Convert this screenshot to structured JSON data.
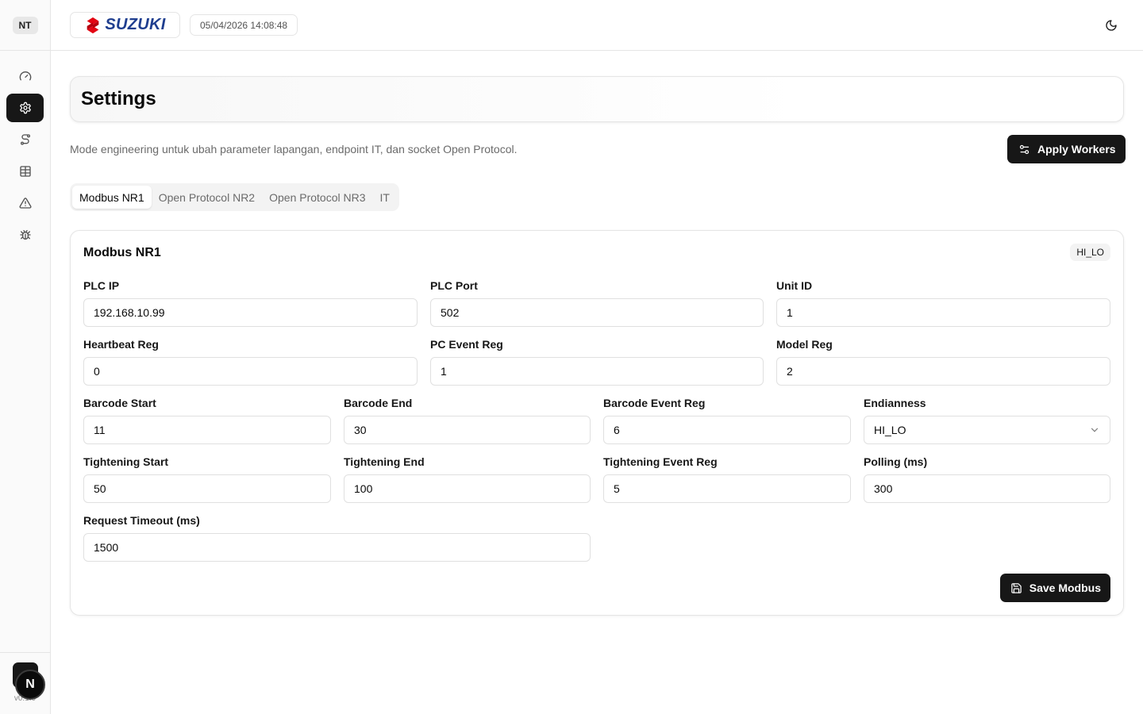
{
  "sidebar": {
    "avatar": "NT",
    "version": "v0.1.0",
    "badge": "N",
    "items": [
      {
        "name": "dashboard",
        "icon": "gauge-icon"
      },
      {
        "name": "settings",
        "icon": "gear-icon",
        "active": true
      },
      {
        "name": "workflow",
        "icon": "workflow-icon"
      },
      {
        "name": "table",
        "icon": "table-icon"
      },
      {
        "name": "alerts",
        "icon": "warning-icon"
      },
      {
        "name": "debug",
        "icon": "bug-icon"
      }
    ]
  },
  "header": {
    "brand": "SUZUKI",
    "datetime": "05/04/2026 14:08:48",
    "theme_icon": "moon-icon"
  },
  "page": {
    "title": "Settings",
    "description": "Mode engineering untuk ubah parameter lapangan, endpoint IT, dan socket Open Protocol.",
    "apply_label": "Apply Workers"
  },
  "tabs": [
    {
      "label": "Modbus NR1",
      "active": true
    },
    {
      "label": "Open Protocol NR2"
    },
    {
      "label": "Open Protocol NR3"
    },
    {
      "label": "IT"
    }
  ],
  "card": {
    "title": "Modbus NR1",
    "badge": "HI_LO",
    "save_label": "Save Modbus",
    "fields": {
      "plc_ip": {
        "label": "PLC IP",
        "value": "192.168.10.99"
      },
      "plc_port": {
        "label": "PLC Port",
        "value": "502"
      },
      "unit_id": {
        "label": "Unit ID",
        "value": "1"
      },
      "heartbeat_reg": {
        "label": "Heartbeat Reg",
        "value": "0"
      },
      "pc_event_reg": {
        "label": "PC Event Reg",
        "value": "1"
      },
      "model_reg": {
        "label": "Model Reg",
        "value": "2"
      },
      "barcode_start": {
        "label": "Barcode Start",
        "value": "11"
      },
      "barcode_end": {
        "label": "Barcode End",
        "value": "30"
      },
      "barcode_event_reg": {
        "label": "Barcode Event Reg",
        "value": "6"
      },
      "endianness": {
        "label": "Endianness",
        "value": "HI_LO"
      },
      "tightening_start": {
        "label": "Tightening Start",
        "value": "50"
      },
      "tightening_end": {
        "label": "Tightening End",
        "value": "100"
      },
      "tightening_event_reg": {
        "label": "Tightening Event Reg",
        "value": "5"
      },
      "polling": {
        "label": "Polling (ms)",
        "value": "300"
      },
      "request_timeout": {
        "label": "Request Timeout (ms)",
        "value": "1500"
      }
    }
  },
  "colors": {
    "accent": "#171717",
    "brand_blue": "#1f3e8f",
    "brand_red": "#e30613"
  }
}
